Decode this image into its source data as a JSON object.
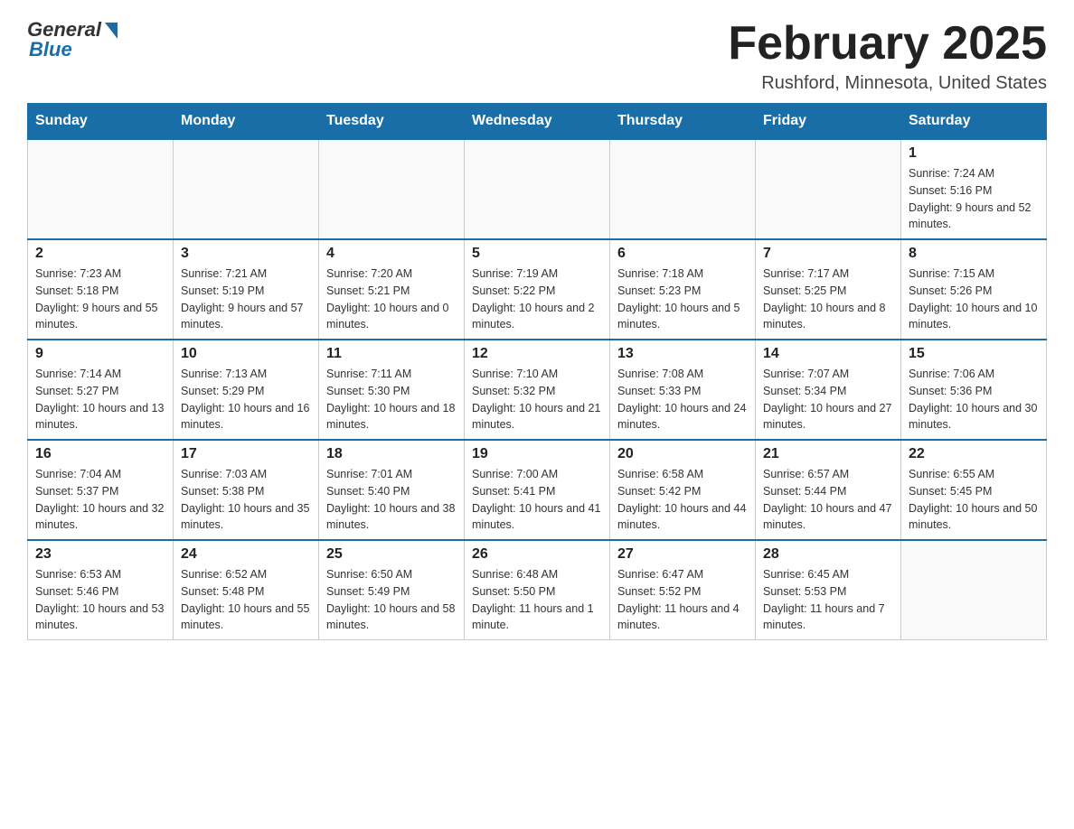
{
  "logo": {
    "general": "General",
    "blue": "Blue"
  },
  "title": "February 2025",
  "location": "Rushford, Minnesota, United States",
  "days_of_week": [
    "Sunday",
    "Monday",
    "Tuesday",
    "Wednesday",
    "Thursday",
    "Friday",
    "Saturday"
  ],
  "weeks": [
    [
      {
        "day": "",
        "info": ""
      },
      {
        "day": "",
        "info": ""
      },
      {
        "day": "",
        "info": ""
      },
      {
        "day": "",
        "info": ""
      },
      {
        "day": "",
        "info": ""
      },
      {
        "day": "",
        "info": ""
      },
      {
        "day": "1",
        "info": "Sunrise: 7:24 AM\nSunset: 5:16 PM\nDaylight: 9 hours and 52 minutes."
      }
    ],
    [
      {
        "day": "2",
        "info": "Sunrise: 7:23 AM\nSunset: 5:18 PM\nDaylight: 9 hours and 55 minutes."
      },
      {
        "day": "3",
        "info": "Sunrise: 7:21 AM\nSunset: 5:19 PM\nDaylight: 9 hours and 57 minutes."
      },
      {
        "day": "4",
        "info": "Sunrise: 7:20 AM\nSunset: 5:21 PM\nDaylight: 10 hours and 0 minutes."
      },
      {
        "day": "5",
        "info": "Sunrise: 7:19 AM\nSunset: 5:22 PM\nDaylight: 10 hours and 2 minutes."
      },
      {
        "day": "6",
        "info": "Sunrise: 7:18 AM\nSunset: 5:23 PM\nDaylight: 10 hours and 5 minutes."
      },
      {
        "day": "7",
        "info": "Sunrise: 7:17 AM\nSunset: 5:25 PM\nDaylight: 10 hours and 8 minutes."
      },
      {
        "day": "8",
        "info": "Sunrise: 7:15 AM\nSunset: 5:26 PM\nDaylight: 10 hours and 10 minutes."
      }
    ],
    [
      {
        "day": "9",
        "info": "Sunrise: 7:14 AM\nSunset: 5:27 PM\nDaylight: 10 hours and 13 minutes."
      },
      {
        "day": "10",
        "info": "Sunrise: 7:13 AM\nSunset: 5:29 PM\nDaylight: 10 hours and 16 minutes."
      },
      {
        "day": "11",
        "info": "Sunrise: 7:11 AM\nSunset: 5:30 PM\nDaylight: 10 hours and 18 minutes."
      },
      {
        "day": "12",
        "info": "Sunrise: 7:10 AM\nSunset: 5:32 PM\nDaylight: 10 hours and 21 minutes."
      },
      {
        "day": "13",
        "info": "Sunrise: 7:08 AM\nSunset: 5:33 PM\nDaylight: 10 hours and 24 minutes."
      },
      {
        "day": "14",
        "info": "Sunrise: 7:07 AM\nSunset: 5:34 PM\nDaylight: 10 hours and 27 minutes."
      },
      {
        "day": "15",
        "info": "Sunrise: 7:06 AM\nSunset: 5:36 PM\nDaylight: 10 hours and 30 minutes."
      }
    ],
    [
      {
        "day": "16",
        "info": "Sunrise: 7:04 AM\nSunset: 5:37 PM\nDaylight: 10 hours and 32 minutes."
      },
      {
        "day": "17",
        "info": "Sunrise: 7:03 AM\nSunset: 5:38 PM\nDaylight: 10 hours and 35 minutes."
      },
      {
        "day": "18",
        "info": "Sunrise: 7:01 AM\nSunset: 5:40 PM\nDaylight: 10 hours and 38 minutes."
      },
      {
        "day": "19",
        "info": "Sunrise: 7:00 AM\nSunset: 5:41 PM\nDaylight: 10 hours and 41 minutes."
      },
      {
        "day": "20",
        "info": "Sunrise: 6:58 AM\nSunset: 5:42 PM\nDaylight: 10 hours and 44 minutes."
      },
      {
        "day": "21",
        "info": "Sunrise: 6:57 AM\nSunset: 5:44 PM\nDaylight: 10 hours and 47 minutes."
      },
      {
        "day": "22",
        "info": "Sunrise: 6:55 AM\nSunset: 5:45 PM\nDaylight: 10 hours and 50 minutes."
      }
    ],
    [
      {
        "day": "23",
        "info": "Sunrise: 6:53 AM\nSunset: 5:46 PM\nDaylight: 10 hours and 53 minutes."
      },
      {
        "day": "24",
        "info": "Sunrise: 6:52 AM\nSunset: 5:48 PM\nDaylight: 10 hours and 55 minutes."
      },
      {
        "day": "25",
        "info": "Sunrise: 6:50 AM\nSunset: 5:49 PM\nDaylight: 10 hours and 58 minutes."
      },
      {
        "day": "26",
        "info": "Sunrise: 6:48 AM\nSunset: 5:50 PM\nDaylight: 11 hours and 1 minute."
      },
      {
        "day": "27",
        "info": "Sunrise: 6:47 AM\nSunset: 5:52 PM\nDaylight: 11 hours and 4 minutes."
      },
      {
        "day": "28",
        "info": "Sunrise: 6:45 AM\nSunset: 5:53 PM\nDaylight: 11 hours and 7 minutes."
      },
      {
        "day": "",
        "info": ""
      }
    ]
  ]
}
